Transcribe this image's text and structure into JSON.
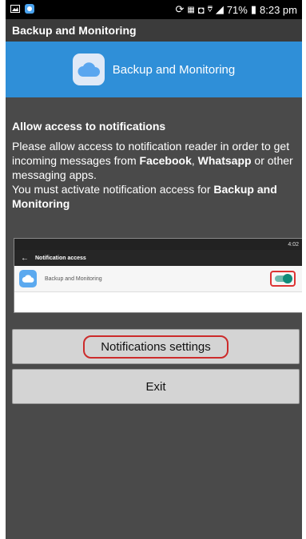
{
  "status_bar": {
    "battery": "71%",
    "time": "8:23 pm"
  },
  "action_bar": {
    "title": "Backup and Monitoring"
  },
  "banner": {
    "title": "Backup and Monitoring",
    "icon": "cloud-icon",
    "color": "#2f8fd8"
  },
  "content": {
    "heading": "Allow access to notifications",
    "line1_start": "Please allow access to notification reader in order to get incoming messages from ",
    "facebook": "Facebook",
    "comma": ", ",
    "whatsapp": "Whatsapp",
    "line1_end": " or other messaging apps.",
    "line2_start": " You must activate notification access for ",
    "app_name": "Backup and Monitoring"
  },
  "example_screenshot": {
    "status_time": "4:02",
    "bar_title": "Notification access",
    "row_label": "Backup and Monitoring",
    "toggle_on": true
  },
  "buttons": {
    "settings": "Notifications settings",
    "exit": "Exit"
  }
}
